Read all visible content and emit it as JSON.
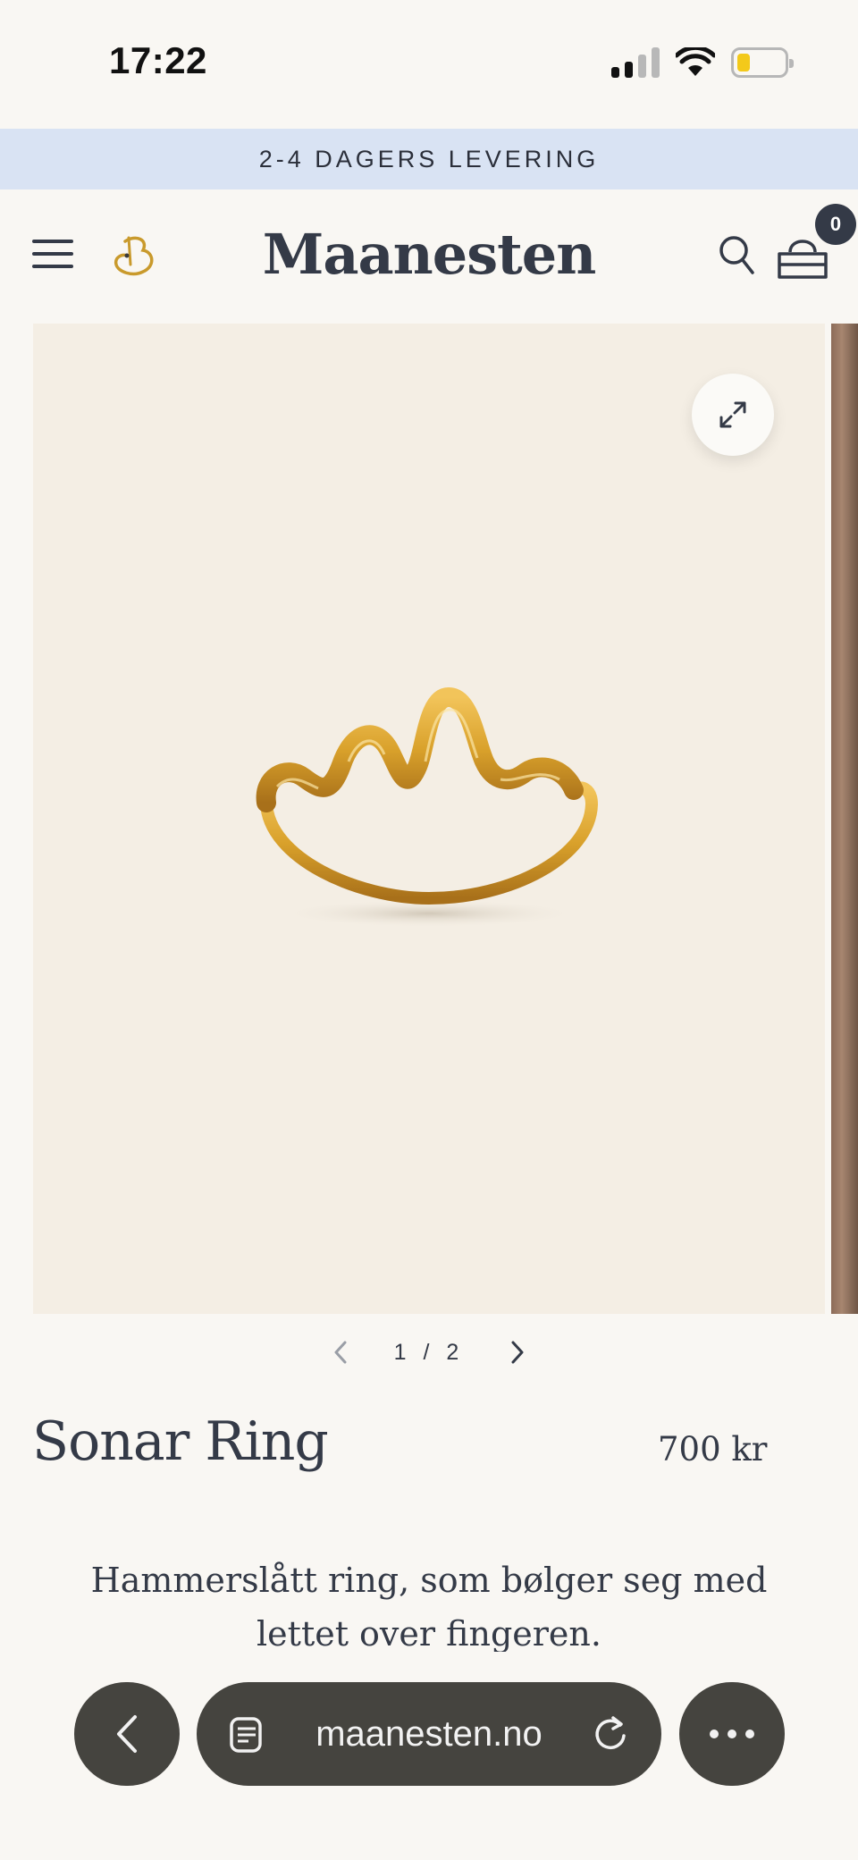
{
  "status_bar": {
    "time": "17:22"
  },
  "announcement": {
    "text": "2-4 DAGERS LEVERING"
  },
  "header": {
    "brand": "Maanesten",
    "cart_count": "0"
  },
  "gallery": {
    "current": "1",
    "separator": "/",
    "total": "2"
  },
  "product": {
    "title": "Sonar Ring",
    "price": "700 kr",
    "description": "Hammerslått ring, som bølger seg med lettet over fingeren."
  },
  "browser": {
    "url": "maanesten.no"
  },
  "colors": {
    "background": "#f9f7f3",
    "announcement_bg": "#d9e3f3",
    "text": "#343a47",
    "gallery_bg": "#f4eee4",
    "gold": "#d9a12b",
    "browser_pill": "#45443f"
  },
  "icons": {
    "menu": "hamburger-menu-icon",
    "logo": "moon-logo-icon",
    "search": "search-icon",
    "cart": "bag-icon",
    "expand": "expand-icon",
    "prev": "chevron-left-icon",
    "next": "chevron-right-icon",
    "back": "back-arrow-icon",
    "tabs": "tabs-icon",
    "reload": "reload-icon",
    "more": "more-dots-icon"
  }
}
